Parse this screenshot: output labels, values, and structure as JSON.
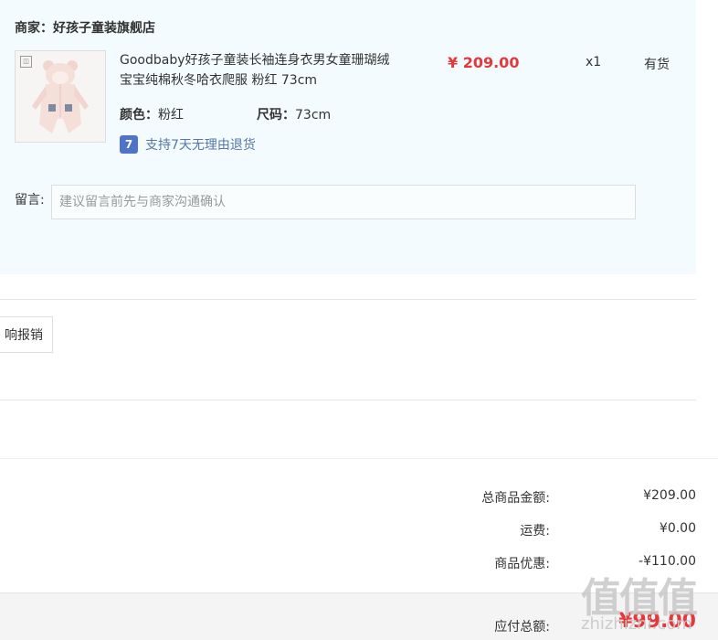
{
  "shop": {
    "label": "商家：好孩子童装旗舰店"
  },
  "product": {
    "title": "Goodbaby好孩子童装长袖连身衣男女童珊瑚绒宝宝纯棉秋冬哈衣爬服 粉红 73cm",
    "color_label": "颜色：",
    "color_value": "粉红",
    "size_label": "尺码：",
    "size_value": "73cm",
    "price": "¥ 209.00",
    "quantity": "x1",
    "stock": "有货",
    "return_policy": "支持7天无理由退货",
    "return_icon_glyph": "7"
  },
  "message": {
    "label": "留言:",
    "placeholder": "建议留言前先与商家沟通确认"
  },
  "reimburse": {
    "label": "响报销"
  },
  "summary": {
    "goods_total_label": "总商品金额:",
    "goods_total_value": "¥209.00",
    "shipping_label": "运费:",
    "shipping_value": "¥0.00",
    "discount_label": "商品优惠:",
    "discount_value": "-¥110.00",
    "payable_label": "应付总额:",
    "payable_value": "¥99.00"
  },
  "watermark": {
    "logo": "值值值",
    "text": "zhizhizhi.com"
  },
  "colors": {
    "panel_bg": "#f3fbfe",
    "price_red": "#e4393c",
    "link_blue": "#5577aa"
  }
}
